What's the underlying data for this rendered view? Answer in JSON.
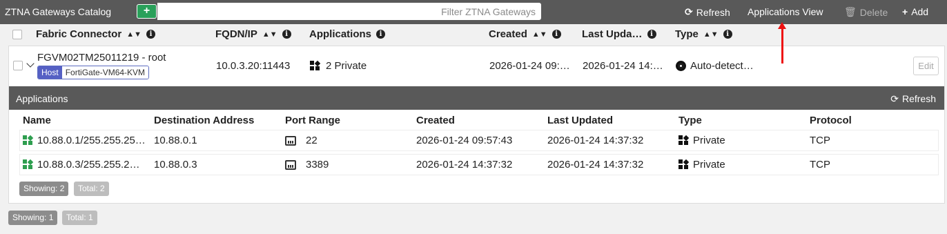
{
  "toolbar": {
    "title": "ZTNA Gateways Catalog",
    "add_glyph": "+",
    "filter_placeholder": "Filter ZTNA Gateways",
    "refresh_label": "Refresh",
    "apps_view_label": "Applications View",
    "delete_label": "Delete",
    "add_label": "Add"
  },
  "table": {
    "headers": {
      "fabric_connector": "Fabric Connector",
      "fqdn": "FQDN/IP",
      "applications": "Applications",
      "created": "Created",
      "last_updated": "Last Upda…",
      "type": "Type"
    },
    "rows": [
      {
        "name": "FGVM02TM25011219 - root",
        "host_key": "Host",
        "host_value": "FortiGate-VM64-KVM",
        "fqdn": "10.0.3.20:11443",
        "applications": "2 Private",
        "created": "2026-01-24 09:…",
        "last_updated": "2026-01-24 14:…",
        "type": "Auto-detect…",
        "edit_label": "Edit"
      }
    ]
  },
  "applications": {
    "title": "Applications",
    "refresh_label": "Refresh",
    "headers": {
      "name": "Name",
      "destination": "Destination Address",
      "port_range": "Port Range",
      "created": "Created",
      "last_updated": "Last Updated",
      "type": "Type",
      "protocol": "Protocol"
    },
    "rows": [
      {
        "name": "10.88.0.1/255.255.25…",
        "destination": "10.88.0.1",
        "port_range": "22",
        "created": "2026-01-24 09:57:43",
        "last_updated": "2026-01-24 14:37:32",
        "type": "Private",
        "protocol": "TCP"
      },
      {
        "name": "10.88.0.3/255.255.2…",
        "destination": "10.88.0.3",
        "port_range": "3389",
        "created": "2026-01-24 14:37:32",
        "last_updated": "2026-01-24 14:37:32",
        "type": "Private",
        "protocol": "TCP"
      }
    ],
    "showing": "Showing: 2",
    "total": "Total: 2"
  },
  "footer": {
    "showing": "Showing: 1",
    "total": "Total: 1"
  },
  "icons": {
    "add": "plus-icon",
    "refresh": "refresh-icon",
    "delete": "trash-icon",
    "info": "info-icon",
    "sort": "sort-icon",
    "app": "app-grid-icon",
    "port": "network-port-icon",
    "type": "target-icon"
  },
  "colors": {
    "toolbar_bg": "#595959",
    "add_green": "#2aa05a",
    "app_icon_green": "#2e9e4f",
    "host_badge": "#5560c4",
    "annotation_arrow": "#ee1111"
  }
}
